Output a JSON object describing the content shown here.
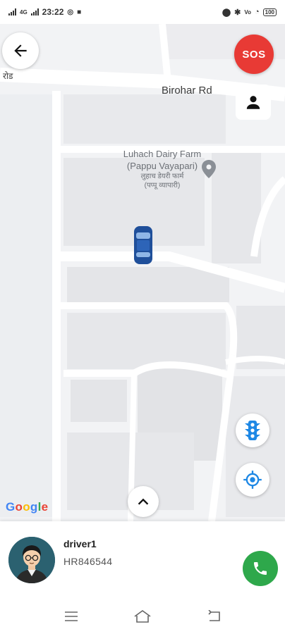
{
  "status_bar": {
    "network": "4G",
    "time": "23:22",
    "battery": "100"
  },
  "map": {
    "street_top_left": "रोड",
    "street_birohar": "Birohar Rd",
    "poi_name_en_line1": "Luhach Dairy Farm",
    "poi_name_en_line2": "(Pappu Vayapari)",
    "poi_name_hi_line1": "लुहाच डेयरी फार्म",
    "poi_name_hi_line2": "(पप्पू व्यापारी)",
    "poi_icon": "location-pin-icon",
    "vehicle_icon": "car-icon"
  },
  "google_logo": {
    "letters": [
      "G",
      "o",
      "o",
      "g",
      "l",
      "e"
    ],
    "colors": [
      "#4285F4",
      "#EA4335",
      "#FBBC05",
      "#4285F4",
      "#34A853",
      "#EA4335"
    ]
  },
  "controls": {
    "back_icon": "arrow-left-icon",
    "sos_label": "SOS",
    "profile_icon": "person-icon",
    "traffic_icon": "traffic-light-icon",
    "locate_icon": "my-location-icon",
    "expand_icon": "chevron-up-icon"
  },
  "driver": {
    "name": "driver1",
    "vehicle_number": "HR846544",
    "call_icon": "phone-icon"
  },
  "nav_bar": {
    "menu_icon": "menu-icon",
    "home_icon": "home-icon",
    "back_icon": "back-icon"
  },
  "colors": {
    "sos": "#e83a35",
    "accent_blue": "#1e88e5",
    "call_green": "#2ea84b",
    "car_blue": "#1f4f9a"
  }
}
